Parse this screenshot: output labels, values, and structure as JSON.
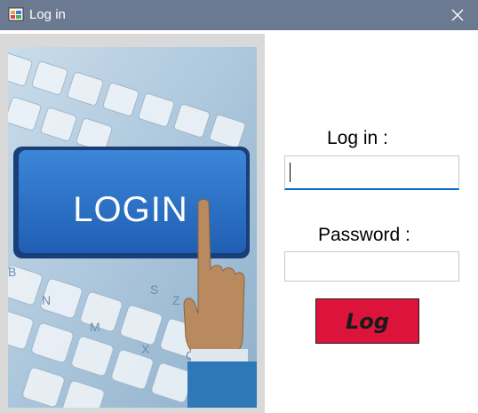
{
  "window": {
    "title": "Log in",
    "titlebar_color": "#6b7a90",
    "icon": "app-form-icon",
    "close_icon": "close-icon"
  },
  "form": {
    "login_label": "Log in :",
    "login_value": "",
    "password_label": "Password :",
    "password_value": "",
    "submit_label": "Log",
    "submit_color": "#dc143c",
    "focus_color": "#0068c8"
  },
  "picture": {
    "button_text": "LOGIN",
    "keyboard_legends": [
      "N",
      "M",
      "B",
      "S",
      "X",
      "C",
      "Z"
    ]
  }
}
